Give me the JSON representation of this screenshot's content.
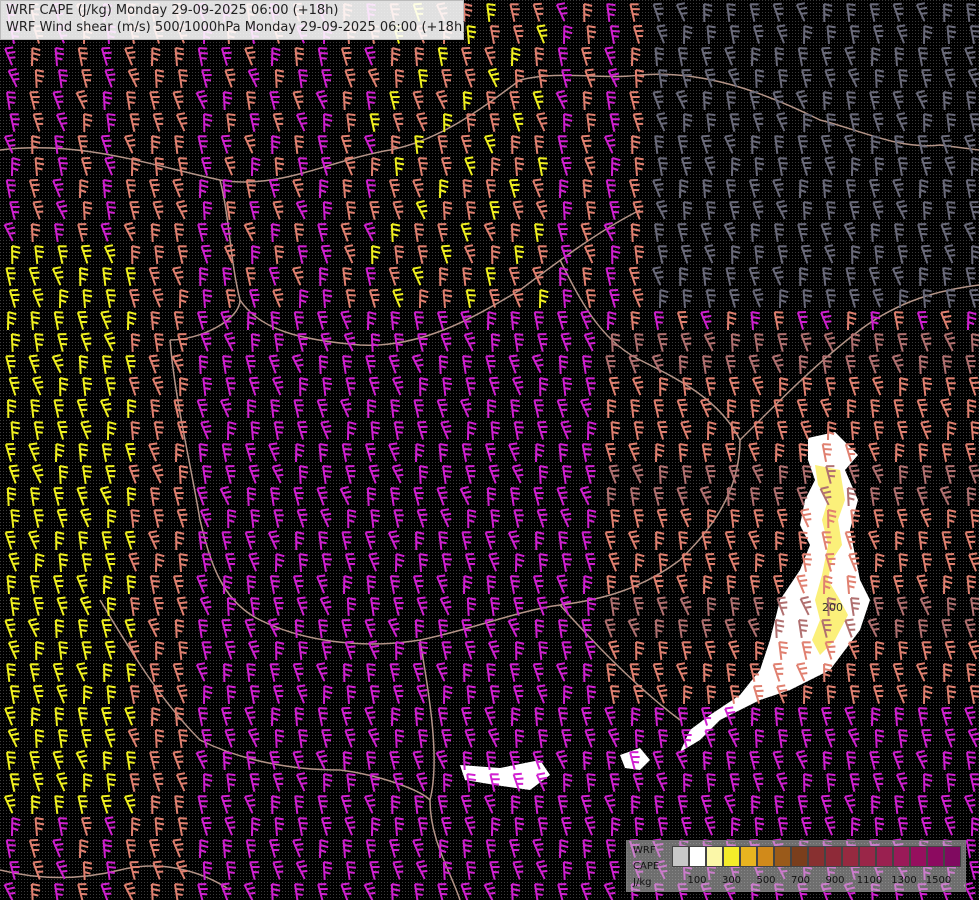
{
  "header": {
    "line1": "WRF CAPE (J/kg) Monday 29-09-2025 06:00 (+18h)",
    "line2": "WRF Wind shear (m/s) 500/1000hPa Monday 29-09-2025 06:00 (+18h)"
  },
  "legend": {
    "label_line1": "WRF",
    "label_line2": "CAPE",
    "label_line3": "J/kg",
    "colors": [
      "#c8c8c8",
      "#ffffff",
      "#fbf7a8",
      "#f4ec2a",
      "#e8b420",
      "#d18a1a",
      "#9a5a1a",
      "#7a3e1c",
      "#883030",
      "#8e2a38",
      "#962a40",
      "#9a2648",
      "#9a2050",
      "#9a1a58",
      "#960f5e",
      "#8c0a60",
      "#800a60"
    ],
    "tick_labels": [
      "100",
      "300",
      "500",
      "700",
      "900",
      "1100",
      "1300",
      "1500"
    ]
  },
  "map_annotations": {
    "cape_contour_label": "200"
  },
  "colors": {
    "shear_low": "#6a6a7a",
    "shear_medium": "#b07070",
    "shear_high": "#e08070",
    "shear_very_high": "#d020d0",
    "shear_extreme": "#f0f020",
    "borders": "#e0b8a8",
    "cape_low": "#ffffff",
    "cape_medium": "#fbf07a"
  }
}
